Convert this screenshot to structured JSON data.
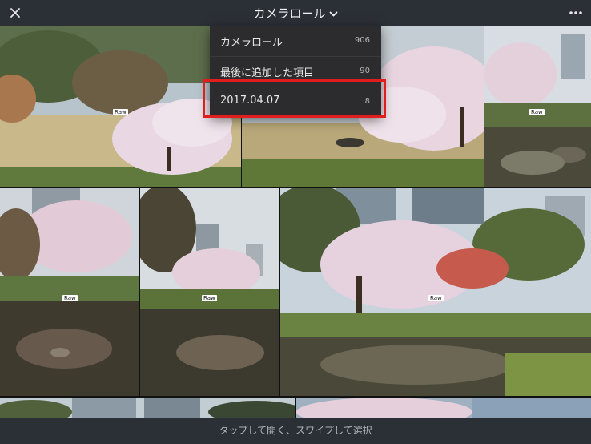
{
  "header": {
    "title": "カメラロール",
    "close_icon": "close-icon",
    "more_icon": "more-icon"
  },
  "albums": [
    {
      "label": "カメラロール",
      "count": "906"
    },
    {
      "label": "最後に追加した項目",
      "count": "90"
    },
    {
      "label": "2017.04.07",
      "count": "8"
    }
  ],
  "photos": {
    "raw_badge": "Raw"
  },
  "footer": {
    "hint": "タップして開く、スワイプして選択"
  },
  "colors": {
    "bar_bg": "#2b2f36",
    "dropdown_bg": "#2c2c2e",
    "highlight": "#e01e1e"
  }
}
